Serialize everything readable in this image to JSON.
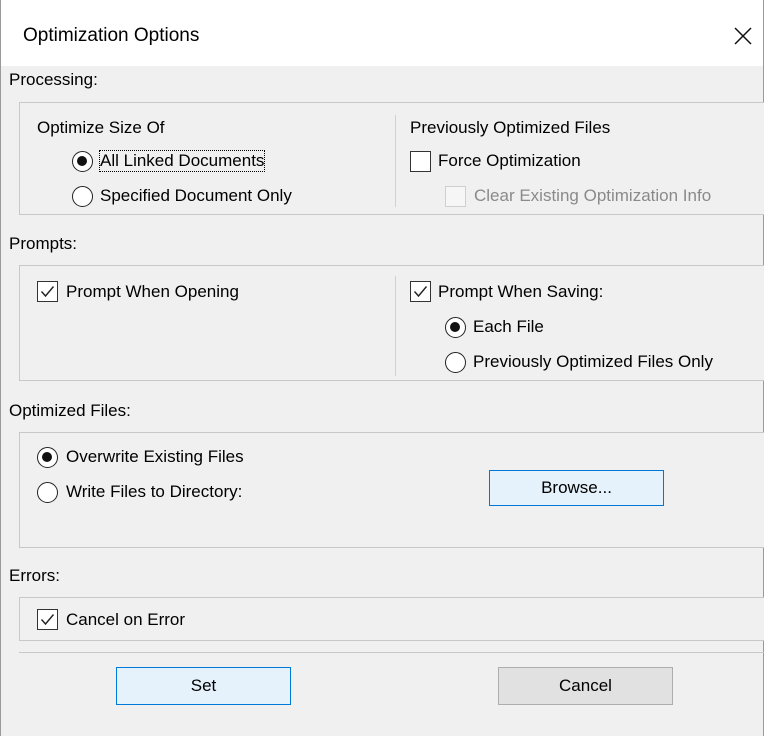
{
  "window": {
    "title": "Optimization Options"
  },
  "processing": {
    "label": "Processing:",
    "optimize_size_of": {
      "heading": "Optimize Size Of",
      "options": [
        {
          "label": "All Linked Documents",
          "selected": true
        },
        {
          "label": "Specified Document Only",
          "selected": false
        }
      ]
    },
    "previously_optimized": {
      "heading": "Previously Optimized Files",
      "force_optimization": {
        "label": "Force Optimization",
        "checked": false
      },
      "clear_info": {
        "label": "Clear Existing Optimization Info",
        "checked": false,
        "enabled": false
      }
    }
  },
  "prompts": {
    "label": "Prompts:",
    "prompt_when_opening": {
      "label": "Prompt When Opening",
      "checked": true
    },
    "prompt_when_saving": {
      "label": "Prompt When Saving:",
      "checked": true
    },
    "saving_options": [
      {
        "label": "Each File",
        "selected": true
      },
      {
        "label": "Previously Optimized Files Only",
        "selected": false
      }
    ]
  },
  "optimized_files": {
    "label": "Optimized Files:",
    "options": [
      {
        "label": "Overwrite Existing Files",
        "selected": true
      },
      {
        "label": "Write Files to Directory:",
        "selected": false
      }
    ],
    "browse_label": "Browse..."
  },
  "errors": {
    "label": "Errors:",
    "cancel_on_error": {
      "label": "Cancel on Error",
      "checked": true
    }
  },
  "buttons": {
    "set": "Set",
    "cancel": "Cancel"
  },
  "icons": {
    "close": "close-icon",
    "checkmark": "checkmark-icon"
  },
  "colors": {
    "default_button_border": "#0078d7",
    "default_button_bg": "#e5f1fb"
  }
}
